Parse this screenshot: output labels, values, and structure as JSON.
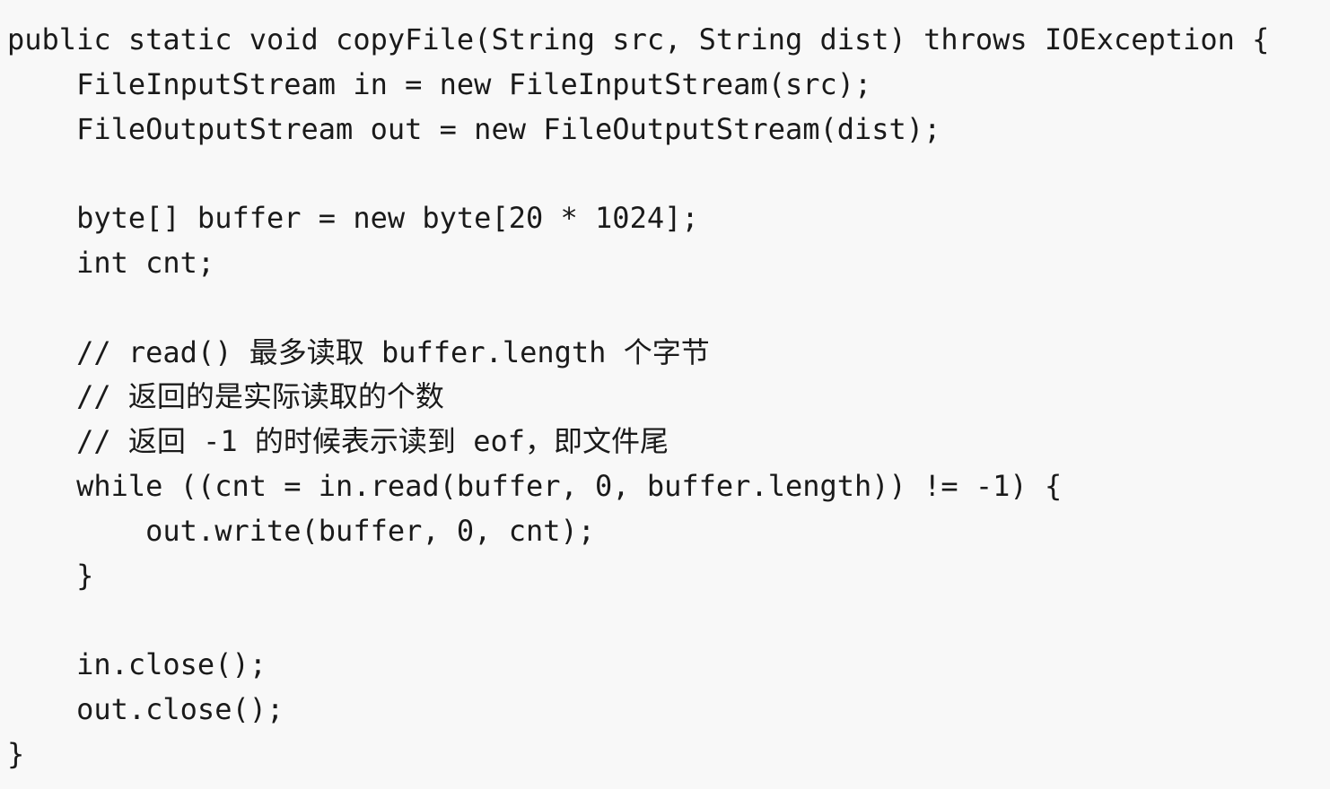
{
  "code": {
    "lines": [
      "public static void copyFile(String src, String dist) throws IOException {",
      "    FileInputStream in = new FileInputStream(src);",
      "    FileOutputStream out = new FileOutputStream(dist);",
      "",
      "    byte[] buffer = new byte[20 * 1024];",
      "    int cnt;",
      "",
      "    // read() 最多读取 buffer.length 个字节",
      "    // 返回的是实际读取的个数",
      "    // 返回 -1 的时候表示读到 eof，即文件尾",
      "    while ((cnt = in.read(buffer, 0, buffer.length)) != -1) {",
      "        out.write(buffer, 0, cnt);",
      "    }",
      "",
      "    in.close();",
      "    out.close();",
      "}"
    ]
  }
}
